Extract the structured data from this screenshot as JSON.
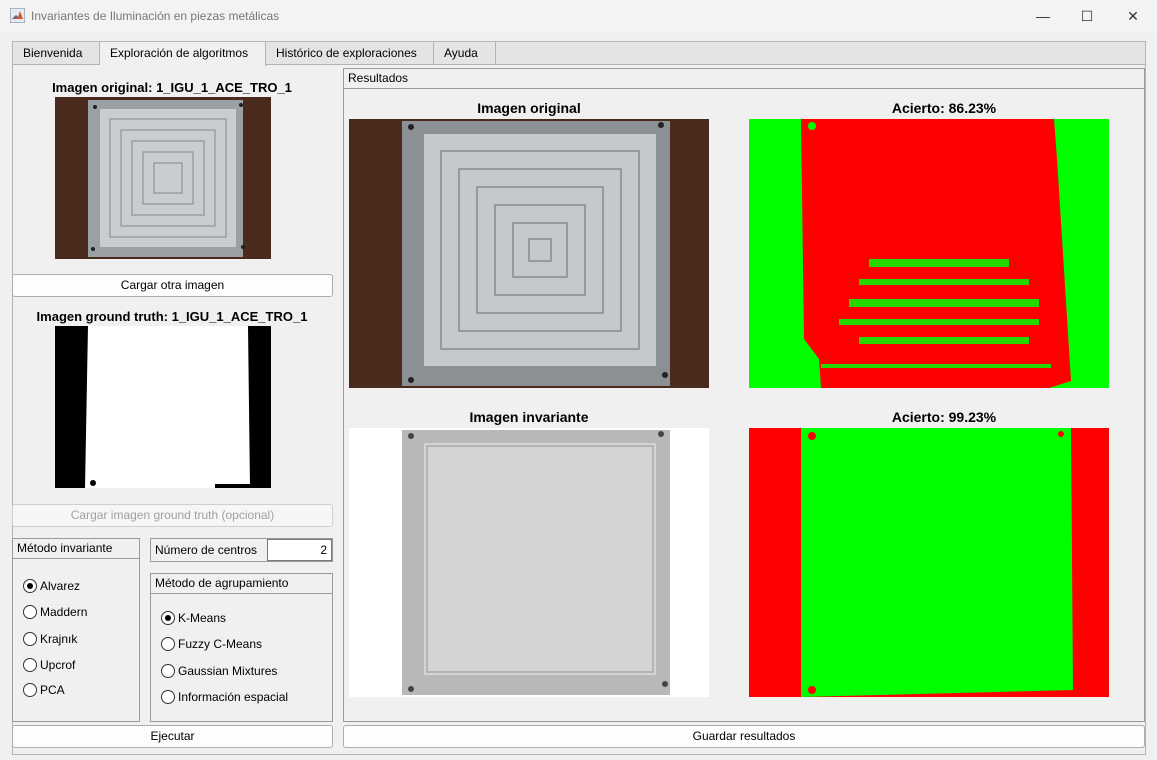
{
  "window": {
    "title": "Invariantes de Iluminación en piezas metálicas",
    "minimize_glyph": "—",
    "maximize_glyph": "☐",
    "close_glyph": "✕"
  },
  "tabs": [
    {
      "label": "Bienvenida"
    },
    {
      "label": "Exploración de algoritmos"
    },
    {
      "label": "Histórico de exploraciones"
    },
    {
      "label": "Ayuda"
    }
  ],
  "left": {
    "original_title": "Imagen original: 1_IGU_1_ACE_TRO_1",
    "load_image_button": "Cargar otra imagen",
    "gt_title": "Imagen ground truth: 1_IGU_1_ACE_TRO_1",
    "load_gt_button": "Cargar imagen ground truth (opcional)",
    "invariant_method": {
      "title": "Método invariante",
      "options": [
        "Alvarez",
        "Maddern",
        "Krajnık",
        "Upcrof",
        "PCA"
      ],
      "selected": "Alvarez"
    },
    "centers": {
      "label": "Número de centros",
      "value": "2"
    },
    "grouping_method": {
      "title": "Método de agrupamiento",
      "options": [
        "K-Means",
        "Fuzzy C-Means",
        "Gaussian Mixtures",
        "Información espacial"
      ],
      "selected": "K-Means"
    },
    "execute_button": "Ejecutar"
  },
  "results": {
    "title": "Resultados",
    "original_image_title": "Imagen original",
    "accuracy_original": "Acierto: 86.23%",
    "invariant_image_title": "Imagen invariante",
    "accuracy_invariant": "Acierto: 99.23%",
    "save_button": "Guardar resultados"
  },
  "colors": {
    "mask_red": "#ff0000",
    "mask_green": "#00ff00",
    "background_brown": "#4a2a1c",
    "window_bg": "#f0f0f0"
  }
}
